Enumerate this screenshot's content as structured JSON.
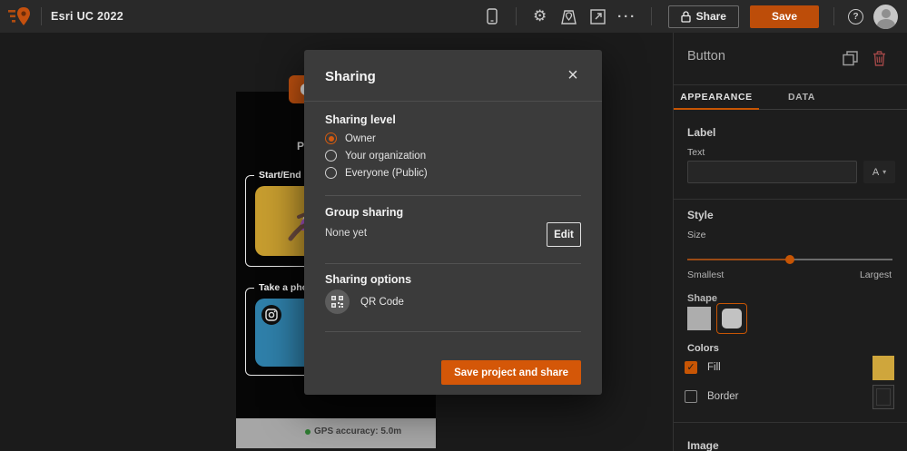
{
  "colors": {
    "accent_orange": "#c75504",
    "save_button": "#bd4d09",
    "modal_submit": "#d45708",
    "fill_swatch": "#cfa63c",
    "tile_yellow": "#c79d2f",
    "tile_blue": "#2f80aa",
    "gps_green": "#2e7d32",
    "trash_red": "#a04747"
  },
  "topbar": {
    "title": "Esri UC 2022",
    "share_label": "Share",
    "save_label": "Save",
    "help_glyph": "?",
    "ellipsis_glyph": "···",
    "gear_glyph": "⚙"
  },
  "canvas": {
    "heading_fragment": "P",
    "groups": [
      {
        "legend": "Start/End"
      },
      {
        "legend": "Take a photo"
      }
    ],
    "status": {
      "gps_text": "GPS accuracy: 5.0m"
    }
  },
  "modal": {
    "title": "Sharing",
    "close_glyph": "×",
    "sharing_level": {
      "heading": "Sharing level",
      "options": [
        {
          "label": "Owner",
          "selected": true
        },
        {
          "label": "Your organization",
          "selected": false
        },
        {
          "label": "Everyone (Public)",
          "selected": false
        }
      ]
    },
    "group_sharing": {
      "heading": "Group sharing",
      "value": "None yet",
      "edit_label": "Edit"
    },
    "sharing_options": {
      "heading": "Sharing options",
      "qr_label": "QR Code"
    },
    "submit_label": "Save project and share"
  },
  "panel": {
    "title": "Button",
    "tabs": [
      {
        "label": "APPEARANCE",
        "active": true
      },
      {
        "label": "DATA",
        "active": false
      }
    ],
    "label_section": {
      "heading": "Label",
      "text_label": "Text",
      "input_value": "",
      "font_selector": "A",
      "font_caret": "▾"
    },
    "style_section": {
      "heading": "Style",
      "size_label": "Size",
      "slider_min": "Smallest",
      "slider_max": "Largest",
      "slider_value_pct": 50,
      "shape_label": "Shape"
    },
    "colors_section": {
      "heading": "Colors",
      "fill": {
        "label": "Fill",
        "checked": true,
        "check_glyph": "✓"
      },
      "border": {
        "label": "Border",
        "checked": false
      }
    },
    "image_section": {
      "heading": "Image"
    }
  }
}
